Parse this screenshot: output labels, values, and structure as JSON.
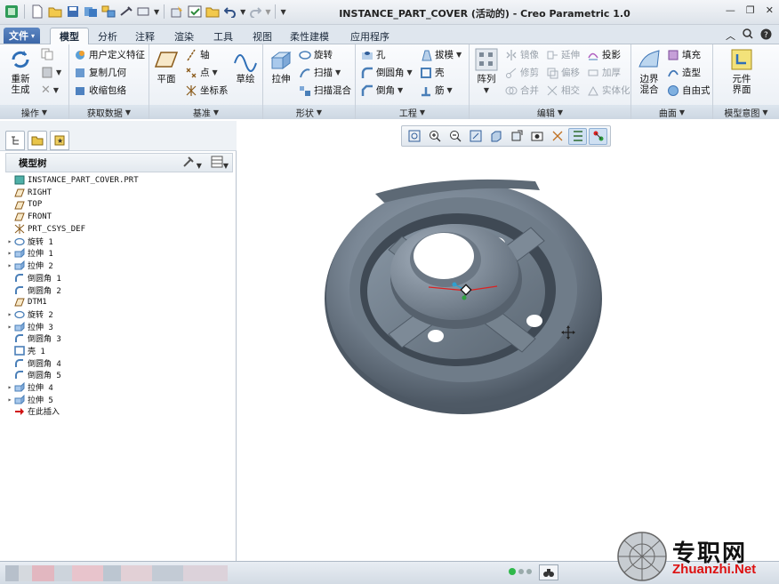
{
  "window": {
    "title": "INSTANCE_PART_COVER (活动的) - Creo Parametric 1.0"
  },
  "tabs": {
    "file": "文件",
    "items": [
      "模型",
      "分析",
      "注释",
      "渲染",
      "工具",
      "视图",
      "柔性建模",
      "应用程序"
    ]
  },
  "ribbon": {
    "ops": {
      "regen": "重新生成",
      "label": "操作"
    },
    "get": {
      "udf": "用户定义特征",
      "copygeom": "复制几何",
      "shrink": "收缩包络",
      "label": "获取数据"
    },
    "datum": {
      "plane": "平面",
      "axis": "轴",
      "point": "点",
      "csys": "坐标系",
      "sketch": "草绘",
      "label": "基准"
    },
    "shape": {
      "extrude": "拉伸",
      "revolve": "旋转",
      "sweep": "扫描",
      "blend": "扫描混合",
      "label": "形状"
    },
    "eng": {
      "hole": "孔",
      "round": "倒圆角",
      "chamfer": "倒角",
      "draft": "拔模",
      "shell": "壳",
      "rib": "筋",
      "label": "工程"
    },
    "edit": {
      "pattern": "阵列",
      "mirror": "镜像",
      "trim": "修剪",
      "merge": "合并",
      "extend": "延伸",
      "offset": "偏移",
      "intersect": "相交",
      "project": "投影",
      "thicken": "加厚",
      "solidify": "实体化",
      "label": "编辑"
    },
    "surf": {
      "boundary": "边界混合",
      "fill": "填充",
      "style": "造型",
      "freeform": "自由式",
      "label": "曲面"
    },
    "intent": {
      "component": "元件界面",
      "label": "模型意图"
    }
  },
  "tree": {
    "title": "模型树",
    "nodes": [
      {
        "label": "INSTANCE_PART_COVER.PRT",
        "icon": "part",
        "exp": ""
      },
      {
        "label": "RIGHT",
        "icon": "plane",
        "exp": ""
      },
      {
        "label": "TOP",
        "icon": "plane",
        "exp": ""
      },
      {
        "label": "FRONT",
        "icon": "plane",
        "exp": ""
      },
      {
        "label": "PRT_CSYS_DEF",
        "icon": "csys",
        "exp": ""
      },
      {
        "label": "旋转 1",
        "icon": "revolve",
        "exp": "▸"
      },
      {
        "label": "拉伸 1",
        "icon": "extrude",
        "exp": "▸"
      },
      {
        "label": "拉伸 2",
        "icon": "extrude",
        "exp": "▸"
      },
      {
        "label": "倒圆角 1",
        "icon": "round",
        "exp": ""
      },
      {
        "label": "倒圆角 2",
        "icon": "round",
        "exp": ""
      },
      {
        "label": "DTM1",
        "icon": "plane",
        "exp": ""
      },
      {
        "label": "旋转 2",
        "icon": "revolve",
        "exp": "▸"
      },
      {
        "label": "拉伸 3",
        "icon": "extrude",
        "exp": "▸"
      },
      {
        "label": "倒圆角 3",
        "icon": "round",
        "exp": ""
      },
      {
        "label": "壳 1",
        "icon": "shell",
        "exp": ""
      },
      {
        "label": "倒圆角 4",
        "icon": "round",
        "exp": ""
      },
      {
        "label": "倒圆角 5",
        "icon": "round",
        "exp": ""
      },
      {
        "label": "拉伸 4",
        "icon": "extrude",
        "exp": "▸"
      },
      {
        "label": "拉伸 5",
        "icon": "extrude",
        "exp": "▸"
      },
      {
        "label": "在此插入",
        "icon": "insert",
        "exp": ""
      }
    ]
  },
  "watermark": {
    "cn": "专职网",
    "url": "Zhuanzhi.Net"
  }
}
